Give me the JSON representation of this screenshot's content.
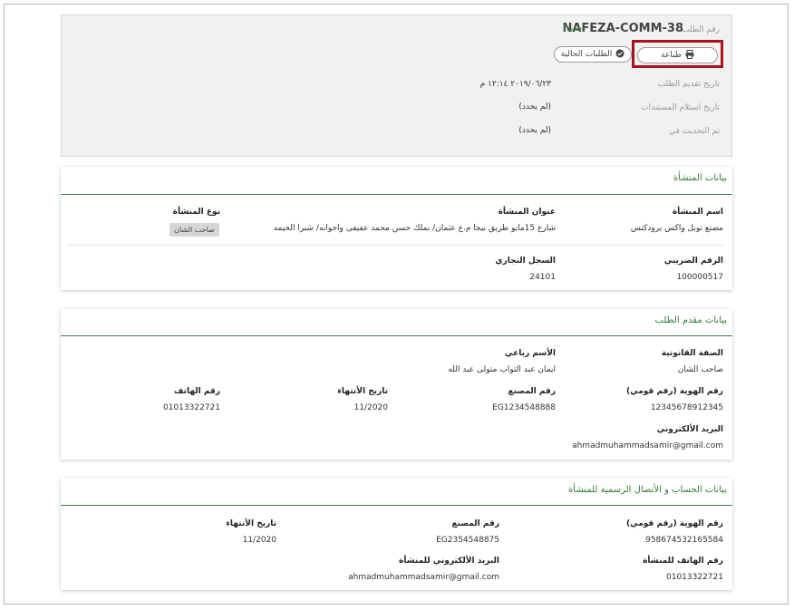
{
  "header": {
    "request_label": "رقم الطلب",
    "request_number": "NAFEZA-COMM-38",
    "status": "[جديد]",
    "print_label": "طباعة",
    "current_requests_label": "الطلبات الحالية",
    "rows": [
      {
        "label": "تاريخ تقديم الطلب",
        "value": "٢٠١٩/٠٦/٢٣ ١٢:١٤ م"
      },
      {
        "label": "تاريخ استلام المستندات",
        "value": "(لم يحدد)"
      },
      {
        "label": "تم التحديث في",
        "value": "(لم يحدد)"
      }
    ]
  },
  "establishment": {
    "title": "بيانات المنشأة",
    "name_label": "اسم المنشأة",
    "name_value": "مصنع نوبل واكس برودكتس",
    "address_label": "عنوان المنشأة",
    "address_value": "شارع 15مايو طريق بيجا م.ع عثمان/ بملك حسن محمد عفيفى واخوانه/ شبرا الخيمه",
    "type_label": "نوع المنشأة",
    "type_value": "صاحب الشان",
    "tax_label": "الرقم الضريبي",
    "tax_value": "100000517",
    "cr_label": "السجل التجاري",
    "cr_value": "24101"
  },
  "applicant": {
    "title": "بيانات مقدم الطلب",
    "capacity_label": "الصفة القانونية",
    "capacity_value": "صاحب الشان",
    "fullname_label": "الأسم رباعي",
    "fullname_value": "ايمان عبد التواب متولى عبد الله",
    "id_label": "رقم الهوية (رقم قومي)",
    "id_value": "12345678912345",
    "factory_label": "رقم المصنع",
    "factory_value": "EG1234548888",
    "expiry_label": "تاريخ الأنتهاء",
    "expiry_value": "11/2020",
    "phone_label": "رقم الهاتف",
    "phone_value": "01013322721",
    "email_label": "البريد الألكتروني",
    "email_value": "ahmadmuhammadsamir@gmail.com"
  },
  "account": {
    "title": "بيانات الحساب و الأتصال الرسمية للمنشأة",
    "id_label": "رقم الهوية (رقم قومي)",
    "id_value": "958674532165584",
    "factory_label": "رقم المصنع",
    "factory_value": "EG2354548875",
    "expiry_label": "تاريخ الأنتهاء",
    "expiry_value": "11/2020",
    "phone_label": "رقم الهاتف للمنشأة",
    "phone_value": "01013322721",
    "email_label": "البريد الألكتروني للمنشأة",
    "email_value": "ahmadmuhammadsamir@gmail.com"
  }
}
